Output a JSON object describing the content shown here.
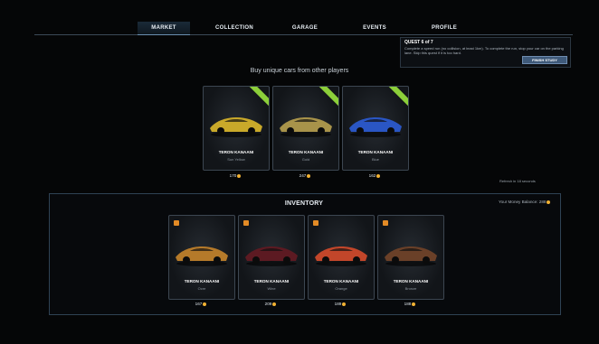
{
  "nav": {
    "tabs": [
      "MARKET",
      "COLLECTION",
      "GARAGE",
      "EVENTS",
      "PROFILE"
    ],
    "active": "MARKET"
  },
  "quest": {
    "title": "QUEST 6 of 7",
    "description": "Complete a speed run (no collision, at least 1km). To complete the run, stop your car on the parking lane. Skip this quest if it is too hard.",
    "button": "FINISH STUDY"
  },
  "market": {
    "headline": "Buy unique cars from other players",
    "refresh": "Refresh in 18 seconds",
    "cards": [
      {
        "name": "TERON KANAANI",
        "variant": "Sun Yellow",
        "price": "170",
        "color": "#c9a92a"
      },
      {
        "name": "TERON KANAANI",
        "variant": "Gold",
        "price": "247",
        "color": "#a8934a"
      },
      {
        "name": "TERON KANAANI",
        "variant": "Blue",
        "price": "162",
        "color": "#2a56c4"
      }
    ]
  },
  "inventory": {
    "title": "INVENTORY",
    "balance_label": "Your Money Balance: 288",
    "cards": [
      {
        "name": "TERON KANAANI",
        "variant": "Ocre",
        "price": "167",
        "color": "#b57a2a"
      },
      {
        "name": "TERON KANAANI",
        "variant": "Wine",
        "price": "209",
        "color": "#5c1a22"
      },
      {
        "name": "TERON KANAANI",
        "variant": "Orange",
        "price": "189",
        "color": "#c2462a"
      },
      {
        "name": "TERON KANAANI",
        "variant": "Bronze",
        "price": "188",
        "color": "#6a4028"
      }
    ]
  },
  "colors": {
    "accent": "#6f8db0",
    "coin": "#f2b233",
    "new_ribbon": "#8ccf3a",
    "owned_badge": "#e38b26"
  }
}
